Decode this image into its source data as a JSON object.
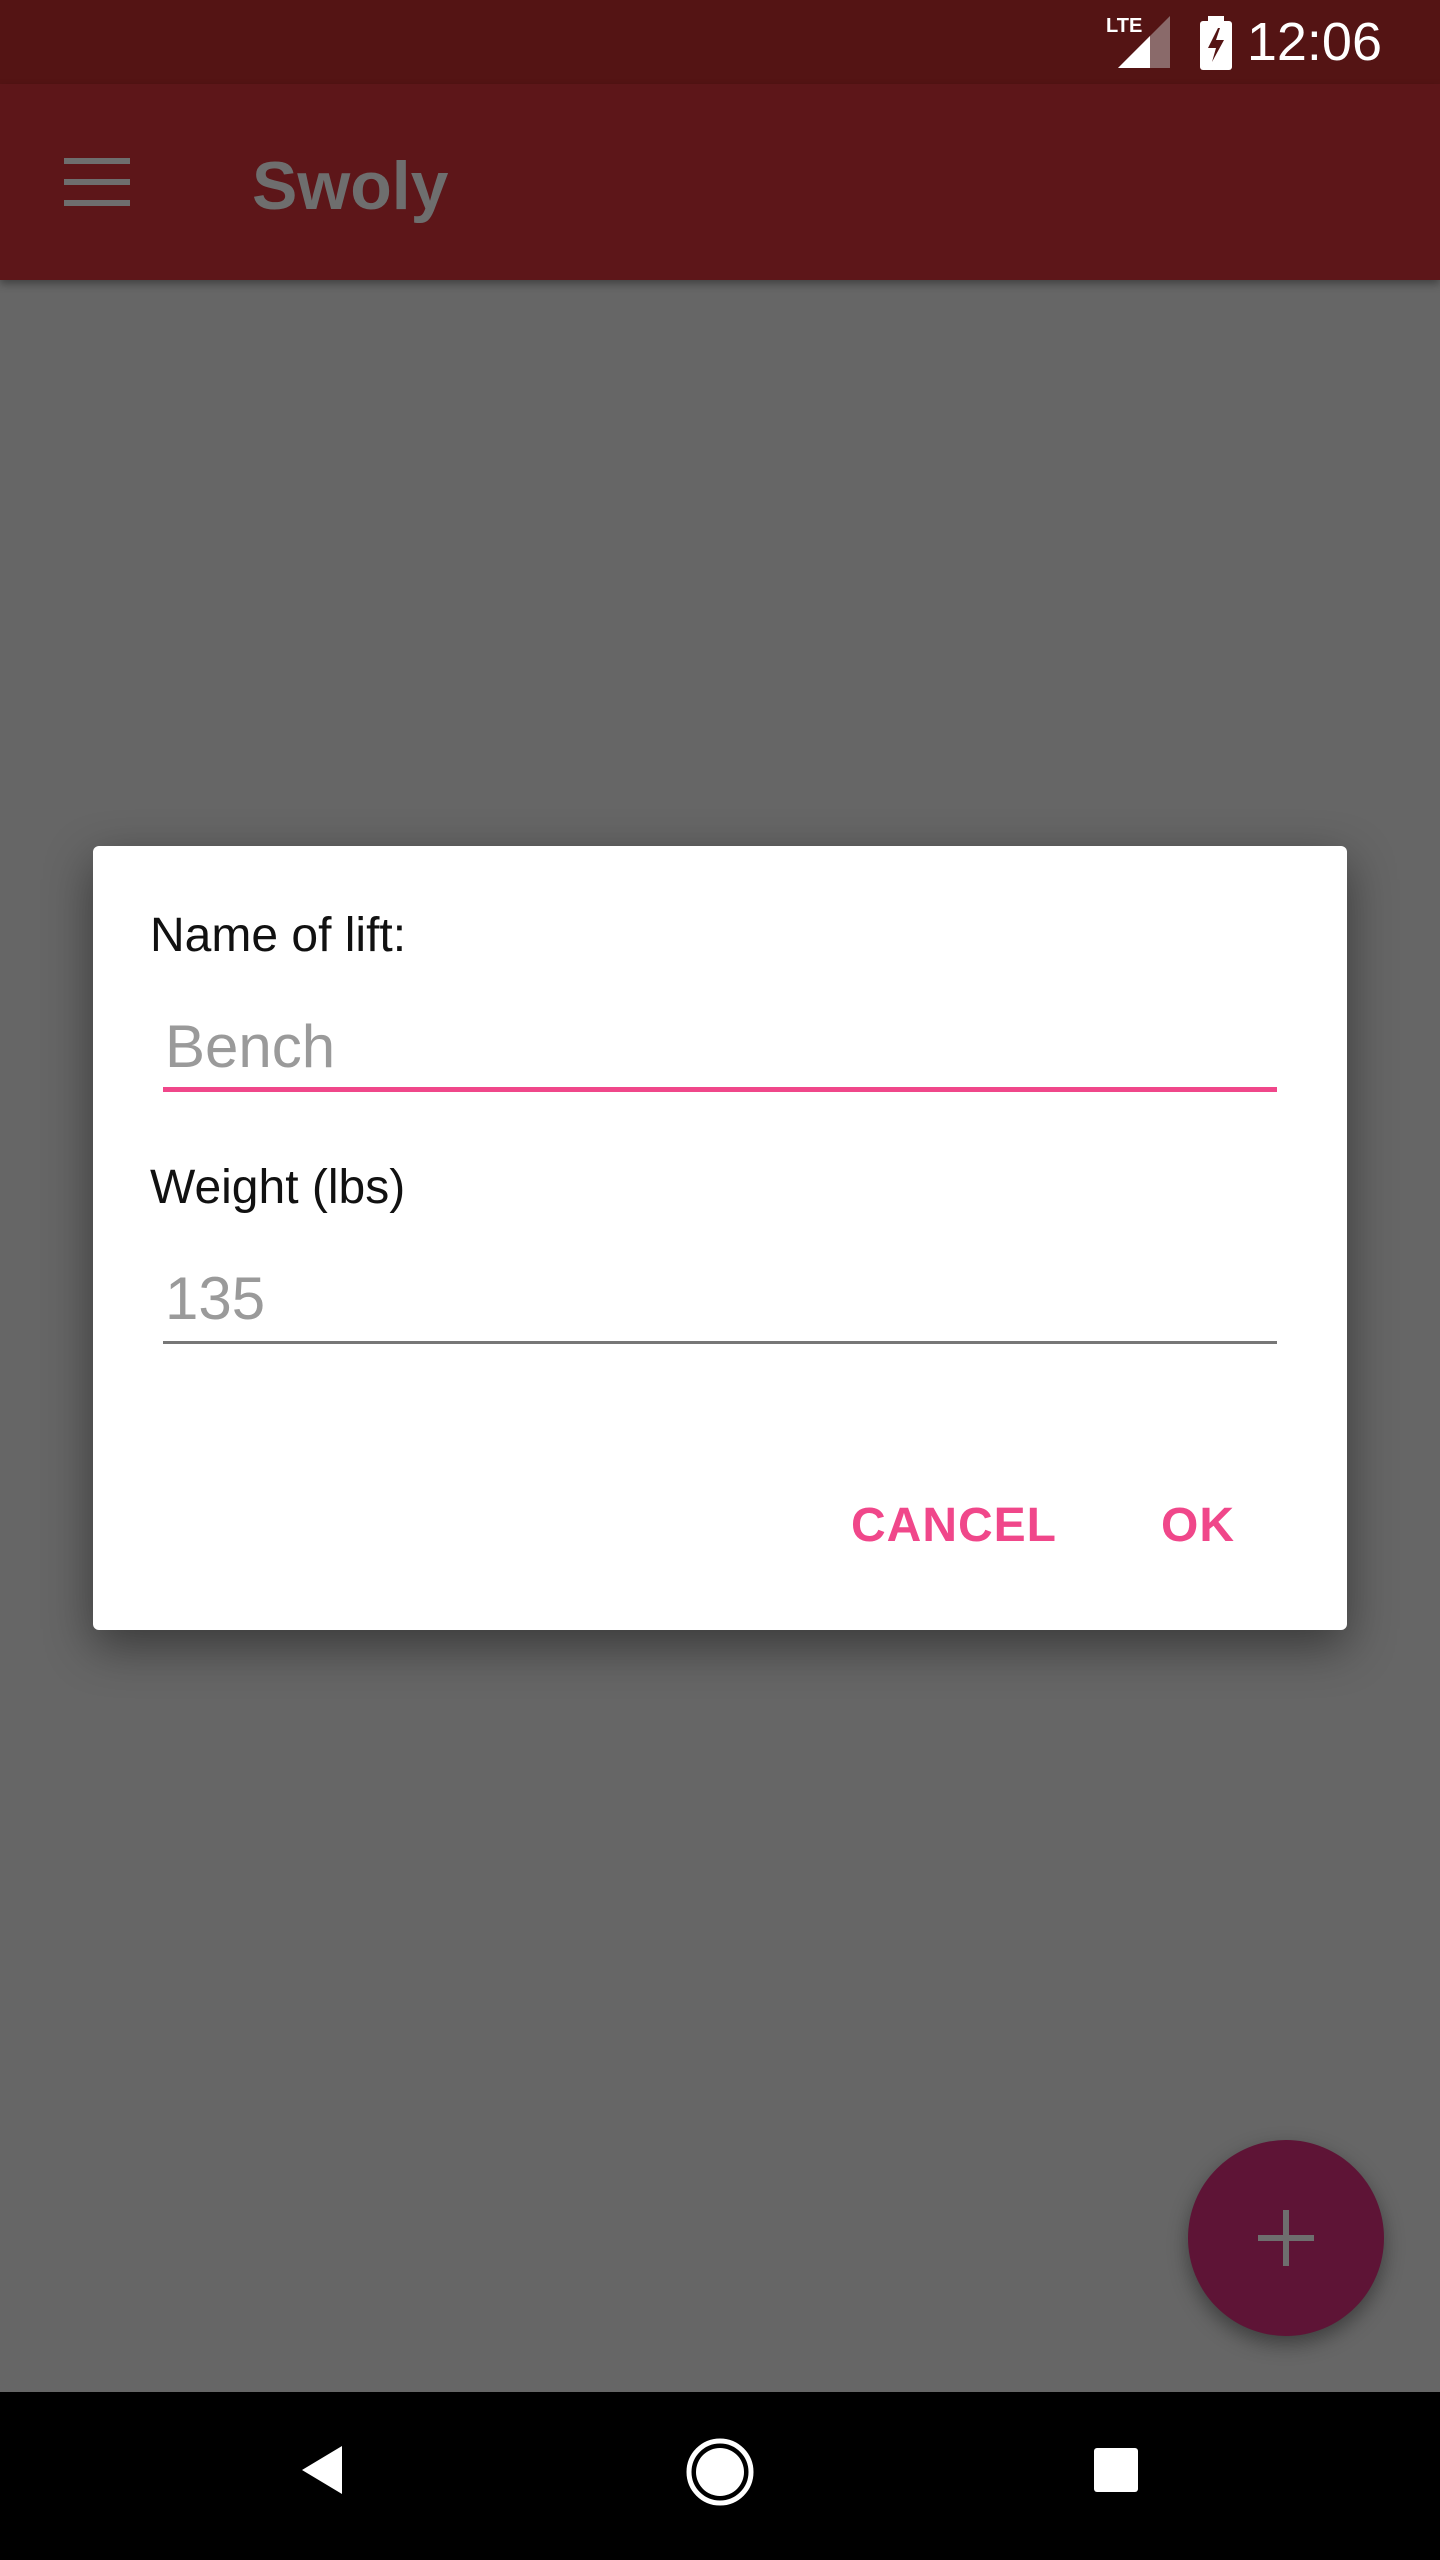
{
  "status_bar": {
    "network_label": "LTE",
    "time": "12:06",
    "icons": [
      "lte-signal-icon",
      "battery-charging-icon"
    ]
  },
  "app_bar": {
    "title": "Swoly",
    "menu_icon": "hamburger-menu-icon"
  },
  "dialog": {
    "name_label": "Name of lift:",
    "name_placeholder": "Bench",
    "weight_label": "Weight (lbs)",
    "weight_placeholder": "135",
    "cancel_label": "CANCEL",
    "ok_label": "OK"
  },
  "fab": {
    "icon": "plus-icon"
  },
  "nav_bar": {
    "icons": [
      "back-icon",
      "home-icon",
      "recents-icon"
    ]
  },
  "colors": {
    "status_bar": "#541414",
    "app_bar": "#5d1619",
    "scrim_background": "#666666",
    "accent": "#f0478a",
    "fab": "#5e1436"
  }
}
